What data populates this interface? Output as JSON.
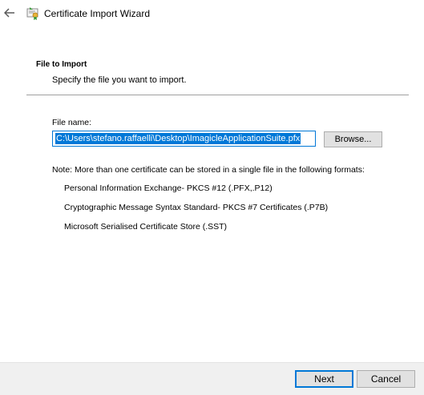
{
  "window": {
    "title": "Certificate Import Wizard"
  },
  "page": {
    "section_title": "File to Import",
    "section_subtitle": "Specify the file you want to import."
  },
  "file": {
    "label": "File name:",
    "value": "C:\\Users\\stefano.raffaelli\\Desktop\\ImagicleApplicationSuite.pfx",
    "browse_label": "Browse..."
  },
  "note": "Note:  More than one certificate can be stored in a single file in the following formats:",
  "formats": [
    "Personal Information Exchange- PKCS #12 (.PFX,.P12)",
    "Cryptographic Message Syntax Standard- PKCS #7 Certificates (.P7B)",
    "Microsoft Serialised Certificate Store (.SST)"
  ],
  "footer": {
    "next_label": "Next",
    "cancel_label": "Cancel"
  },
  "colors": {
    "accent": "#0078d7",
    "footer_bg": "#f0f0f0",
    "button_bg": "#e1e1e1"
  },
  "icons": {
    "back": "back-arrow-icon",
    "app": "certificate-icon"
  }
}
